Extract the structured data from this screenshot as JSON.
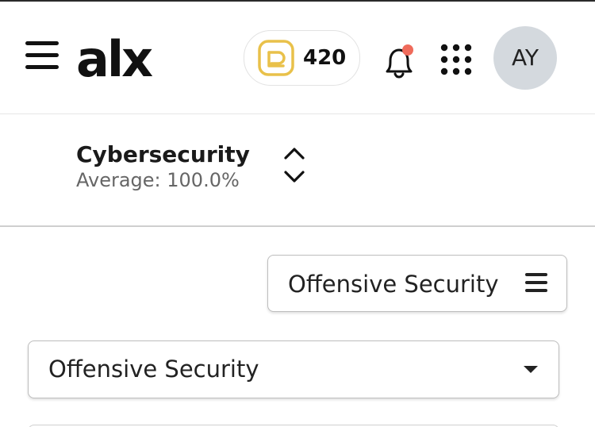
{
  "header": {
    "menu_icon": "hamburger-menu-icon",
    "logo_text": "alx",
    "coins": {
      "icon": "coin-icon",
      "value": "420",
      "color": "#e9c14a"
    },
    "notifications": {
      "icon": "bell-icon",
      "has_unread": true,
      "dot_color": "#ef6b5b"
    },
    "apps_icon": "grid-dots-icon",
    "avatar": {
      "initials": "AY",
      "background": "#d4d9de"
    }
  },
  "course": {
    "title": "Cybersecurity",
    "average": "Average: 100.0%",
    "prev_icon": "chevron-up-icon",
    "next_icon": "chevron-down-icon"
  },
  "filter": {
    "label": "Offensive Security",
    "icon": "menu-lines-icon"
  },
  "select": {
    "value": "Offensive Security",
    "icon": "caret-down-icon"
  }
}
